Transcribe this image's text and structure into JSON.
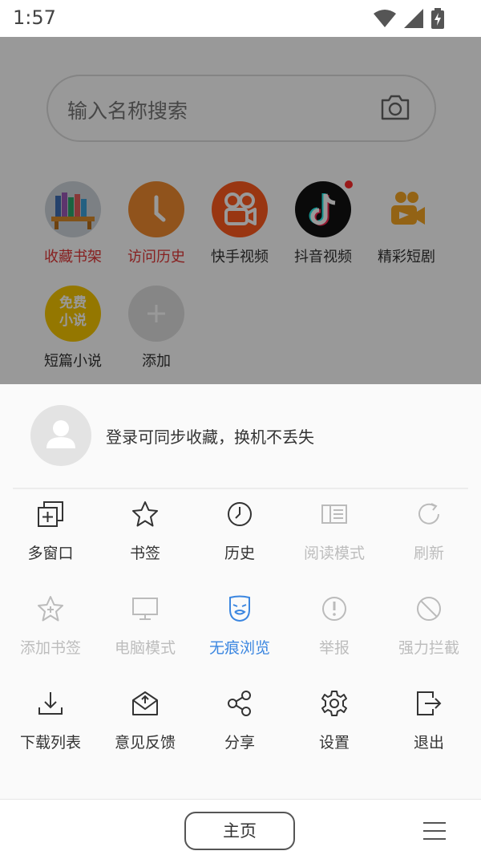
{
  "status_bar": {
    "time": "1:57",
    "icons": [
      "wifi-icon",
      "cell-signal-icon",
      "battery-charging-icon"
    ]
  },
  "search": {
    "placeholder": "输入名称搜索",
    "icon": "camera-icon"
  },
  "shortcuts": [
    {
      "label": "收藏书架",
      "icon": "bookshelf-icon",
      "highlight": true
    },
    {
      "label": "访问历史",
      "icon": "clock-icon",
      "highlight": true
    },
    {
      "label": "快手视频",
      "icon": "kuaishou-icon",
      "highlight": false
    },
    {
      "label": "抖音视频",
      "icon": "douyin-icon",
      "highlight": false,
      "badge_dot": true
    },
    {
      "label": "精彩短剧",
      "icon": "short-drama-icon",
      "highlight": false
    },
    {
      "label": "短篇小说",
      "icon": "free-novel-icon",
      "highlight": false,
      "icon_text": [
        "免费",
        "小说"
      ]
    },
    {
      "label": "添加",
      "icon": "plus-icon",
      "highlight": false
    }
  ],
  "sheet": {
    "login_prompt": "登录可同步收藏，换机不丢失",
    "menu": [
      {
        "label": "多窗口",
        "icon": "multi-window-icon",
        "state": "normal"
      },
      {
        "label": "书签",
        "icon": "star-icon",
        "state": "normal"
      },
      {
        "label": "历史",
        "icon": "history-icon",
        "state": "normal"
      },
      {
        "label": "阅读模式",
        "icon": "reading-mode-icon",
        "state": "disabled"
      },
      {
        "label": "刷新",
        "icon": "refresh-icon",
        "state": "disabled"
      },
      {
        "label": "添加书签",
        "icon": "add-bookmark-icon",
        "state": "disabled"
      },
      {
        "label": "电脑模式",
        "icon": "desktop-icon",
        "state": "disabled"
      },
      {
        "label": "无痕浏览",
        "icon": "incognito-mask-icon",
        "state": "active"
      },
      {
        "label": "举报",
        "icon": "report-icon",
        "state": "disabled"
      },
      {
        "label": "强力拦截",
        "icon": "block-icon",
        "state": "disabled"
      },
      {
        "label": "下载列表",
        "icon": "download-icon",
        "state": "normal"
      },
      {
        "label": "意见反馈",
        "icon": "feedback-icon",
        "state": "normal"
      },
      {
        "label": "分享",
        "icon": "share-icon",
        "state": "normal"
      },
      {
        "label": "设置",
        "icon": "gear-icon",
        "state": "normal"
      },
      {
        "label": "退出",
        "icon": "exit-icon",
        "state": "normal"
      }
    ]
  },
  "bottom_bar": {
    "home_label": "主页",
    "menu_icon": "hamburger-icon"
  },
  "colors": {
    "highlight_red": "#e23636",
    "active_blue": "#3b86e0",
    "disabled_gray": "#bdbdbd",
    "orange": "#f08a30"
  }
}
